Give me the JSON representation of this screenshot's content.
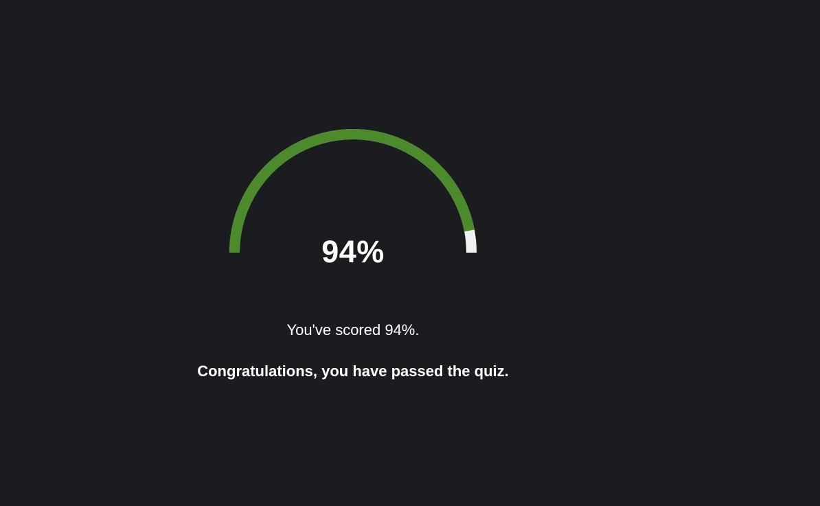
{
  "score": {
    "percent_text": "94%",
    "fraction": 0.94,
    "fill_color": "#4b8b2b",
    "track_color": "#f1f1f1"
  },
  "messages": {
    "score_text": "You've scored 94%.",
    "result_text": "Congratulations, you have passed the quiz."
  },
  "colors": {
    "background": "#1b1c20",
    "text": "#ffffff"
  }
}
